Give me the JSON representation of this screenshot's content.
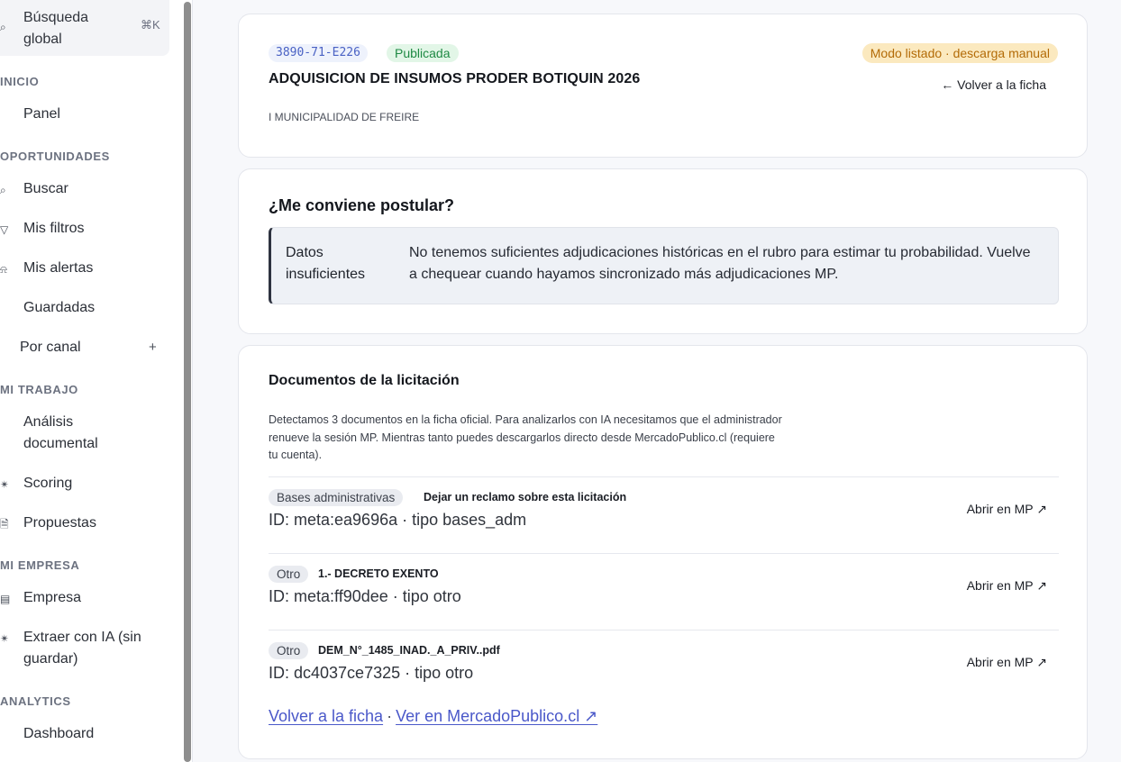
{
  "sidebar": {
    "search": {
      "label": "Búsqueda global",
      "shortcut": "⌘K"
    },
    "sections": {
      "inicio": "INICIO",
      "oportunidades": "OPORTUNIDADES",
      "mi_trabajo": "MI TRABAJO",
      "mi_empresa": "MI EMPRESA",
      "analytics": "ANALYTICS"
    },
    "items": {
      "panel": "Panel",
      "buscar": "Buscar",
      "mis_filtros": "Mis filtros",
      "mis_alertas": "Mis alertas",
      "guardadas": "Guardadas",
      "por_canal": "Por canal",
      "analisis": "Análisis documental",
      "scoring": "Scoring",
      "propuestas": "Propuestas",
      "empresa": "Empresa",
      "extraer": "Extraer con IA (sin guardar)",
      "dashboard": "Dashboard"
    },
    "add_symbol": "+"
  },
  "header": {
    "code": "3890-71-E226",
    "status": "Publicada",
    "mode": "Modo listado · descarga manual",
    "title": "ADQUISICION DE INSUMOS PRODER BOTIQUIN 2026",
    "back": "← Volver a la ficha",
    "organization": "I MUNICIPALIDAD DE FREIRE"
  },
  "eligibility": {
    "title": "¿Me conviene postular?",
    "notice_label": "Datos insuficientes",
    "notice_text": "No tenemos suficientes adjudicaciones históricas en el rubro para estimar tu probabilidad. Vuelve a chequear cuando hayamos sincronizado más adjudicaciones MP."
  },
  "documents": {
    "title": "Documentos de la licitación",
    "description": "Detectamos 3 documentos en la ficha oficial. Para analizarlos con IA necesitamos que el administrador renueve la sesión MP. Mientras tanto puedes descargarlos directo desde MercadoPublico.cl (requiere tu cuenta).",
    "open_label": "Abrir en MP ↗",
    "items": [
      {
        "tag": "Bases administrativas",
        "name": "Dejar un reclamo sobre esta licitación",
        "id": "ID: meta:ea9696a · tipo bases_adm"
      },
      {
        "tag": "Otro",
        "name": "1.- DECRETO EXENTO",
        "id": "ID: meta:ff90dee · tipo otro"
      },
      {
        "tag": "Otro",
        "name": "DEM_N°_1485_INAD._A_PRIV..pdf",
        "id": "ID: dc4037ce7325 · tipo otro"
      }
    ],
    "footer": {
      "back": "Volver a la ficha",
      "separator": "·",
      "mp": "Ver en MercadoPublico.cl ↗"
    }
  }
}
